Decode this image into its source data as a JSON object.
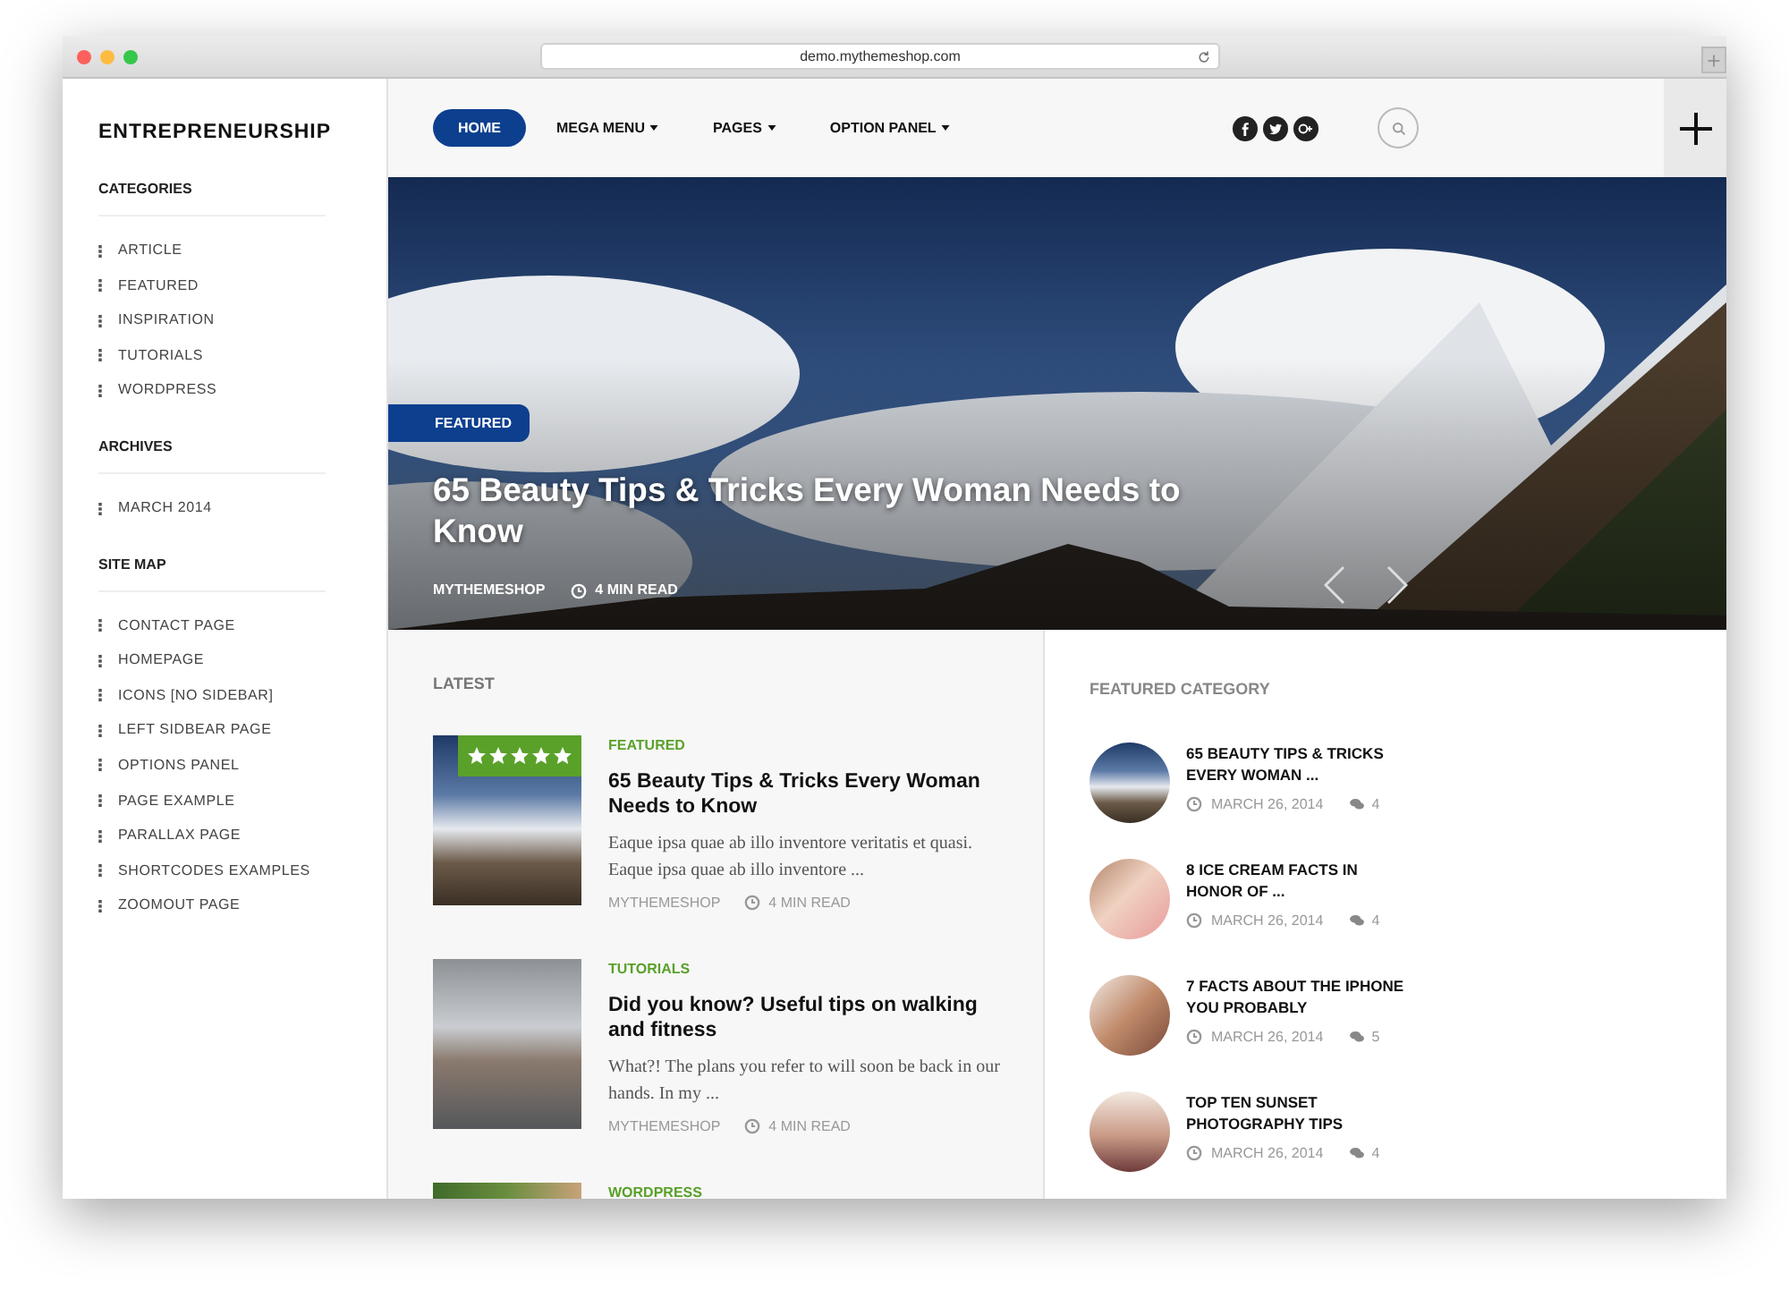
{
  "browser": {
    "url": "demo.mythemeshop.com"
  },
  "sidebar": {
    "title": "ENTREPRENEURSHIP",
    "sections": [
      {
        "heading": "CATEGORIES",
        "items": [
          "ARTICLE",
          "FEATURED",
          "INSPIRATION",
          "TUTORIALS",
          "WORDPRESS"
        ]
      },
      {
        "heading": "ARCHIVES",
        "items": [
          "MARCH 2014"
        ]
      },
      {
        "heading": "SITE MAP",
        "items": [
          "CONTACT PAGE",
          "HOMEPAGE",
          "ICONS [NO SIDEBAR]",
          "LEFT SIDBEAR PAGE",
          "OPTIONS PANEL",
          "PAGE EXAMPLE",
          "PARALLAX PAGE",
          "SHORTCODES EXAMPLES",
          "ZOOMOUT PAGE"
        ]
      }
    ]
  },
  "nav": {
    "items": [
      {
        "label": "HOME",
        "selected": true,
        "dropdown": false
      },
      {
        "label": "MEGA MENU",
        "selected": false,
        "dropdown": true
      },
      {
        "label": "PAGES",
        "selected": false,
        "dropdown": true
      },
      {
        "label": "OPTION PANEL",
        "selected": false,
        "dropdown": true
      }
    ],
    "social": [
      {
        "kind": "facebook"
      },
      {
        "kind": "twitter"
      },
      {
        "kind": "googleplus"
      }
    ]
  },
  "hero": {
    "badge": "FEATURED",
    "title": "65 Beauty Tips & Tricks Every Woman Needs to Know",
    "author": "MYTHEMESHOP",
    "read_time": "4 MIN READ"
  },
  "latest": {
    "heading": "LATEST",
    "posts": [
      {
        "category": "FEATURED",
        "title": "65 Beauty Tips & Tricks Every Woman Needs to Know",
        "excerpt": "Eaque ipsa quae ab illo inventore veritatis et quasi. Eaque ipsa quae ab illo inventore ...",
        "author": "MYTHEMESHOP",
        "read_time": "4 MIN READ",
        "stars": 5
      },
      {
        "category": "TUTORIALS",
        "title": "Did you know? Useful tips on walking and fitness",
        "excerpt": "What?! The plans you refer to will soon be back in our hands. In my ...",
        "author": "MYTHEMESHOP",
        "read_time": "4 MIN READ"
      },
      {
        "category": "WORDPRESS"
      }
    ]
  },
  "featured": {
    "heading": "FEATURED CATEGORY",
    "posts": [
      {
        "title": "65 BEAUTY TIPS & TRICKS EVERY WOMAN ...",
        "date": "MARCH 26, 2014",
        "comments": "4"
      },
      {
        "title": "8 ICE CREAM FACTS IN HONOR OF ...",
        "date": "MARCH 26, 2014",
        "comments": "4"
      },
      {
        "title": "7 FACTS ABOUT THE IPHONE YOU PROBABLY",
        "date": "MARCH 26, 2014",
        "comments": "5"
      },
      {
        "title": "TOP TEN SUNSET PHOTOGRAPHY TIPS",
        "date": "MARCH 26, 2014",
        "comments": "4"
      }
    ]
  }
}
